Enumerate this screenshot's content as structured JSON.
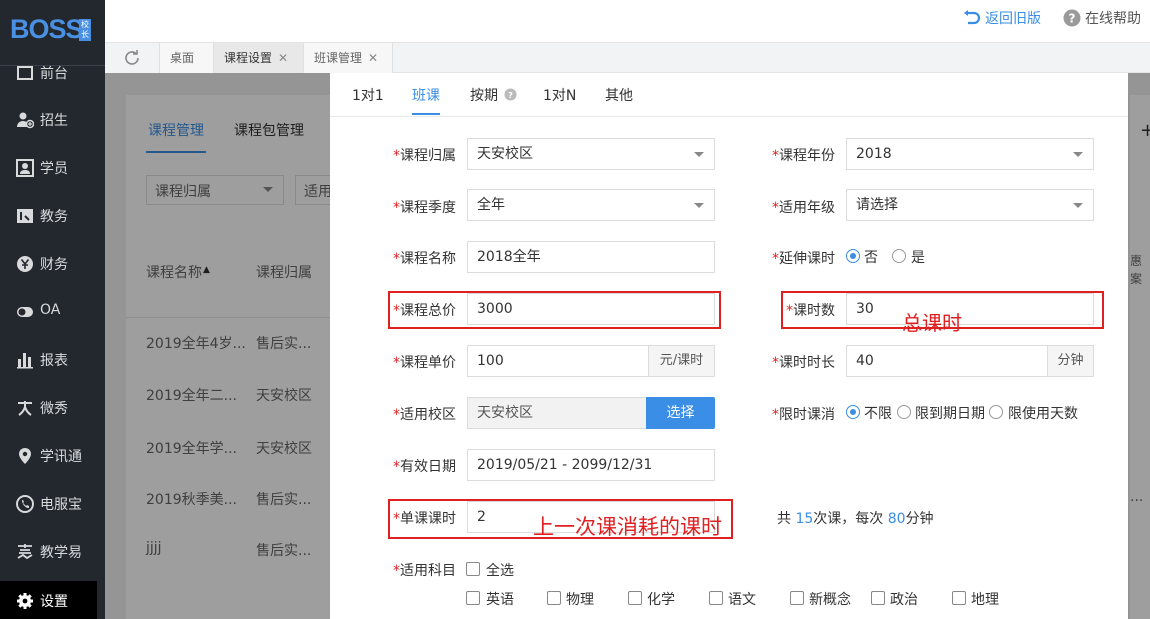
{
  "app": {
    "logo": "BOSS",
    "logo_badge": "校长"
  },
  "sidebar": {
    "items": [
      {
        "label": "前台",
        "icon": "desk-icon"
      },
      {
        "label": "招生",
        "icon": "user-add-icon"
      },
      {
        "label": "学员",
        "icon": "student-icon"
      },
      {
        "label": "教务",
        "icon": "book-icon"
      },
      {
        "label": "财务",
        "icon": "yen-icon"
      },
      {
        "label": "OA",
        "icon": "toggle-icon"
      },
      {
        "label": "报表",
        "icon": "bar-chart-icon"
      },
      {
        "label": "微秀",
        "icon": "show-icon"
      },
      {
        "label": "学讯通",
        "icon": "location-icon"
      },
      {
        "label": "电服宝",
        "icon": "phone-icon"
      },
      {
        "label": "教学易",
        "icon": "teach-icon"
      },
      {
        "label": "设置",
        "icon": "gear-icon",
        "active": true
      }
    ]
  },
  "topbar": {
    "back_old": "返回旧版",
    "help": "在线帮助"
  },
  "tabs": [
    {
      "label": "桌面"
    },
    {
      "label": "课程设置",
      "closable": true,
      "active": true
    },
    {
      "label": "班课管理",
      "closable": true
    }
  ],
  "background_page": {
    "subtabs": [
      "课程管理",
      "课程包管理"
    ],
    "filter": "课程归属",
    "filter2": "适用",
    "columns": [
      "课程名称",
      "课程归属"
    ],
    "rows": [
      [
        "2019全年4岁...",
        "售后实..."
      ],
      [
        "2019全年二...",
        "天安校区"
      ],
      [
        "2019全年学...",
        "天安校区"
      ],
      [
        "2019秋季美...",
        "售后实..."
      ],
      [
        "jjjj",
        "售后实..."
      ]
    ],
    "right_col": "惠 案",
    "right_ellipsis": "..."
  },
  "modal": {
    "tabs": [
      "1对1",
      "班课",
      "按期",
      "1对N",
      "其他"
    ],
    "active_tab": "班课",
    "form": {
      "course_owner": {
        "label": "课程归属",
        "value": "天安校区"
      },
      "course_year": {
        "label": "课程年份",
        "value": "2018"
      },
      "season": {
        "label": "课程季度",
        "value": "全年"
      },
      "grade": {
        "label": "适用年级",
        "value": "请选择"
      },
      "course_name": {
        "label": "课程名称",
        "value": "2018全年"
      },
      "extend": {
        "label": "延伸课时",
        "options": [
          "否",
          "是"
        ],
        "selected": "否"
      },
      "total_price": {
        "label": "课程总价",
        "value": "3000"
      },
      "hours": {
        "label": "课时数",
        "value": "30"
      },
      "unit_price": {
        "label": "课程单价",
        "value": "100",
        "suffix": "元/课时"
      },
      "hour_length": {
        "label": "课时时长",
        "value": "40",
        "suffix": "分钟"
      },
      "campus": {
        "label": "适用校区",
        "value": "天安校区",
        "button": "选择"
      },
      "limit": {
        "label": "限时课消",
        "options": [
          "不限",
          "限到期日期",
          "限使用天数"
        ],
        "selected": "不限"
      },
      "valid_date": {
        "label": "有效日期",
        "value": "2019/05/21 - 2099/12/31"
      },
      "single_hours": {
        "label": "单课课时",
        "value": "2"
      },
      "summary": {
        "prefix": "共",
        "count": "15",
        "mid": "次课，每次",
        "minutes": "80",
        "suffix": "分钟"
      },
      "subjects": {
        "label": "适用科目",
        "all": "全选",
        "items": [
          "英语",
          "物理",
          "化学",
          "语文",
          "新概念",
          "政治",
          "地理"
        ]
      }
    },
    "annotations": {
      "total_hours": "总课时",
      "single_consume": "上一次课消耗的课时"
    }
  },
  "colors": {
    "accent": "#3a8ee6",
    "annotation": "#e02020",
    "sidebar": "#22282e"
  }
}
